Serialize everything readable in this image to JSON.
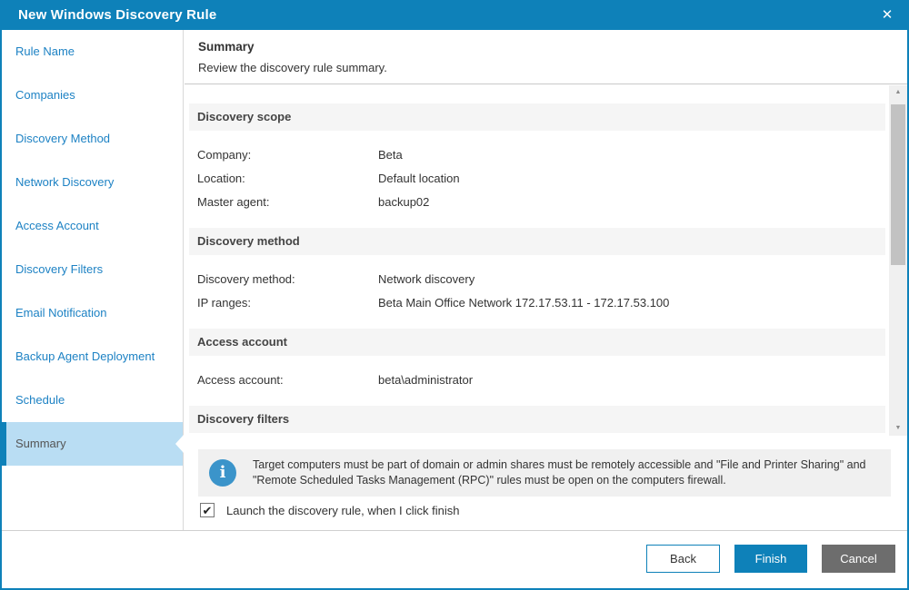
{
  "colors": {
    "accent": "#0e81b9",
    "link": "#1d82c4",
    "selected-bg": "#b9ddf3",
    "cancel-gray": "#6d6d6d",
    "info-icon": "#3b94ca"
  },
  "window": {
    "title": "New Windows Discovery Rule",
    "close_icon": "✕"
  },
  "sidebar": {
    "items": [
      {
        "label": "Rule Name",
        "selected": false
      },
      {
        "label": "Companies",
        "selected": false
      },
      {
        "label": "Discovery Method",
        "selected": false
      },
      {
        "label": "Network Discovery",
        "selected": false
      },
      {
        "label": "Access Account",
        "selected": false
      },
      {
        "label": "Discovery Filters",
        "selected": false
      },
      {
        "label": "Email Notification",
        "selected": false
      },
      {
        "label": "Backup Agent Deployment",
        "selected": false
      },
      {
        "label": "Schedule",
        "selected": false
      },
      {
        "label": "Summary",
        "selected": true
      }
    ]
  },
  "header": {
    "title": "Summary",
    "subtitle": "Review the discovery rule summary."
  },
  "sections": [
    {
      "title": "Discovery scope",
      "rows": [
        {
          "label": "Company:",
          "value": "Beta"
        },
        {
          "label": "Location:",
          "value": "Default location"
        },
        {
          "label": "Master agent:",
          "value": "backup02"
        }
      ]
    },
    {
      "title": "Discovery method",
      "rows": [
        {
          "label": "Discovery method:",
          "value": "Network discovery"
        },
        {
          "label": "IP ranges:",
          "value": "Beta Main Office Network 172.17.53.11 - 172.17.53.100"
        }
      ]
    },
    {
      "title": "Access account",
      "rows": [
        {
          "label": "Access account:",
          "value": "beta\\administrator"
        }
      ]
    },
    {
      "title": "Discovery filters",
      "rows": []
    }
  ],
  "info": {
    "icon_glyph": "i",
    "text": "Target computers must be part of domain or admin shares must be remotely accessible and \"File and Printer Sharing\" and \"Remote Scheduled Tasks Management (RPC)\" rules must be open on the computers firewall."
  },
  "launch": {
    "checked": true,
    "check_glyph": "✔",
    "label": "Launch the discovery rule, when I click finish"
  },
  "buttons": {
    "back": "Back",
    "finish": "Finish",
    "cancel": "Cancel"
  },
  "scrollbar": {
    "up_glyph": "▲",
    "down_glyph": "▼"
  }
}
